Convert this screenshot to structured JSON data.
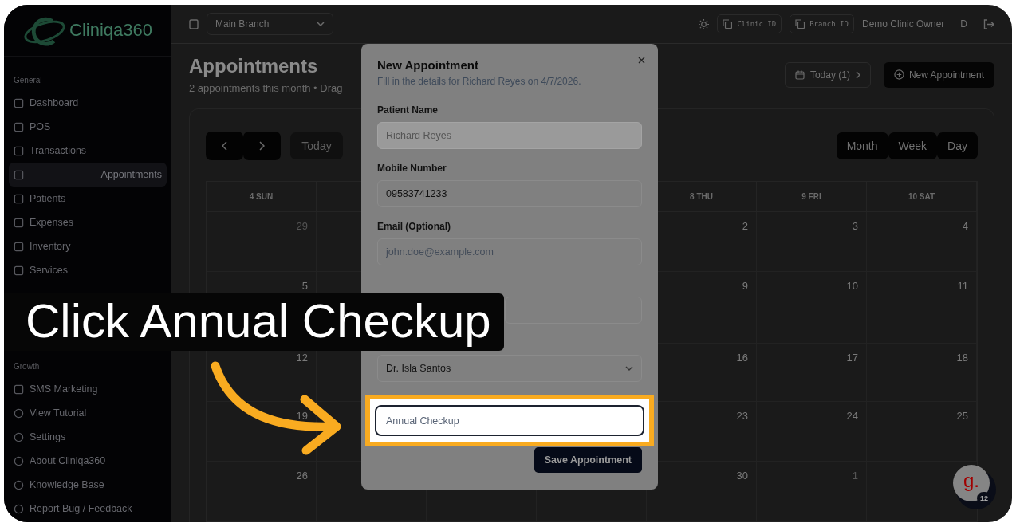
{
  "tutorial": {
    "caption": "Click Annual Checkup"
  },
  "sidebar": {
    "logo": "Cliniqa360",
    "sections": [
      {
        "title": "General",
        "items": [
          {
            "label": "Dashboard",
            "selected": false
          },
          {
            "label": "POS",
            "selected": false
          },
          {
            "label": "Transactions",
            "selected": false
          },
          {
            "label": "Appointments",
            "selected": true
          },
          {
            "label": "Patients",
            "selected": false
          },
          {
            "label": "Expenses",
            "selected": false
          },
          {
            "label": "Inventory",
            "selected": false
          },
          {
            "label": "Services",
            "selected": false
          }
        ]
      },
      {
        "title": "Growth",
        "items": [
          {
            "label": "SMS Marketing",
            "selected": false
          }
        ]
      }
    ],
    "footer_items": [
      "View Tutorial",
      "Settings",
      "About Cliniqa360",
      "Knowledge Base",
      "Report Bug / Feedback"
    ]
  },
  "topbar": {
    "branch": "Main Branch",
    "clinic_id": "Clinic ID",
    "branch_id": "Branch ID",
    "user": "Demo Clinic Owner",
    "avatar": "D"
  },
  "page": {
    "title": "Appointments",
    "subtitle": "2 appointments this month • Drag",
    "today_button": "Today (1)",
    "new_button": "New Appointment"
  },
  "calendar": {
    "today": "Today",
    "views": [
      "Month",
      "Week",
      "Day"
    ],
    "columns": [
      {
        "header": "4 SUN",
        "days": [
          {
            "n": "29",
            "muted": true
          },
          {
            "n": "5",
            "muted": false
          },
          {
            "n": "12",
            "muted": false
          },
          {
            "n": "19",
            "muted": false
          },
          {
            "n": "26",
            "muted": false
          }
        ]
      },
      {
        "header": "8 THU",
        "days": [
          {
            "n": "2",
            "muted": false
          },
          {
            "n": "9",
            "muted": false
          },
          {
            "n": "16",
            "muted": false
          },
          {
            "n": "23",
            "muted": false
          },
          {
            "n": "30",
            "muted": false
          }
        ]
      },
      {
        "header": "9 FRI",
        "days": [
          {
            "n": "3",
            "muted": false
          },
          {
            "n": "10",
            "muted": false
          },
          {
            "n": "17",
            "muted": false
          },
          {
            "n": "24",
            "muted": false
          },
          {
            "n": "1",
            "muted": true
          }
        ]
      },
      {
        "header": "10 SAT",
        "days": [
          {
            "n": "4",
            "muted": false
          },
          {
            "n": "11",
            "muted": false
          },
          {
            "n": "18",
            "muted": false
          },
          {
            "n": "25",
            "muted": false
          }
        ]
      }
    ]
  },
  "modal": {
    "title": "New Appointment",
    "subtitle": "Fill in the details for Richard Reyes on 4/7/2026.",
    "fields": [
      {
        "kind": "text",
        "label": "Patient Name",
        "value": "Richard Reyes",
        "disabled": true
      },
      {
        "kind": "text",
        "label": "Mobile Number",
        "value": "09583741233",
        "disabled": false
      },
      {
        "kind": "text",
        "label": "Email (Optional)",
        "placeholder": "john.doe@example.com",
        "disabled": false
      },
      {
        "kind": "pair"
      },
      {
        "kind": "select",
        "value": "Dr. Isla Santos"
      },
      {
        "kind": "highlight",
        "placeholder": "Annual Checkup"
      }
    ],
    "save": "Save Appointment"
  },
  "chat": {
    "logo": "g.",
    "badge": "12"
  }
}
